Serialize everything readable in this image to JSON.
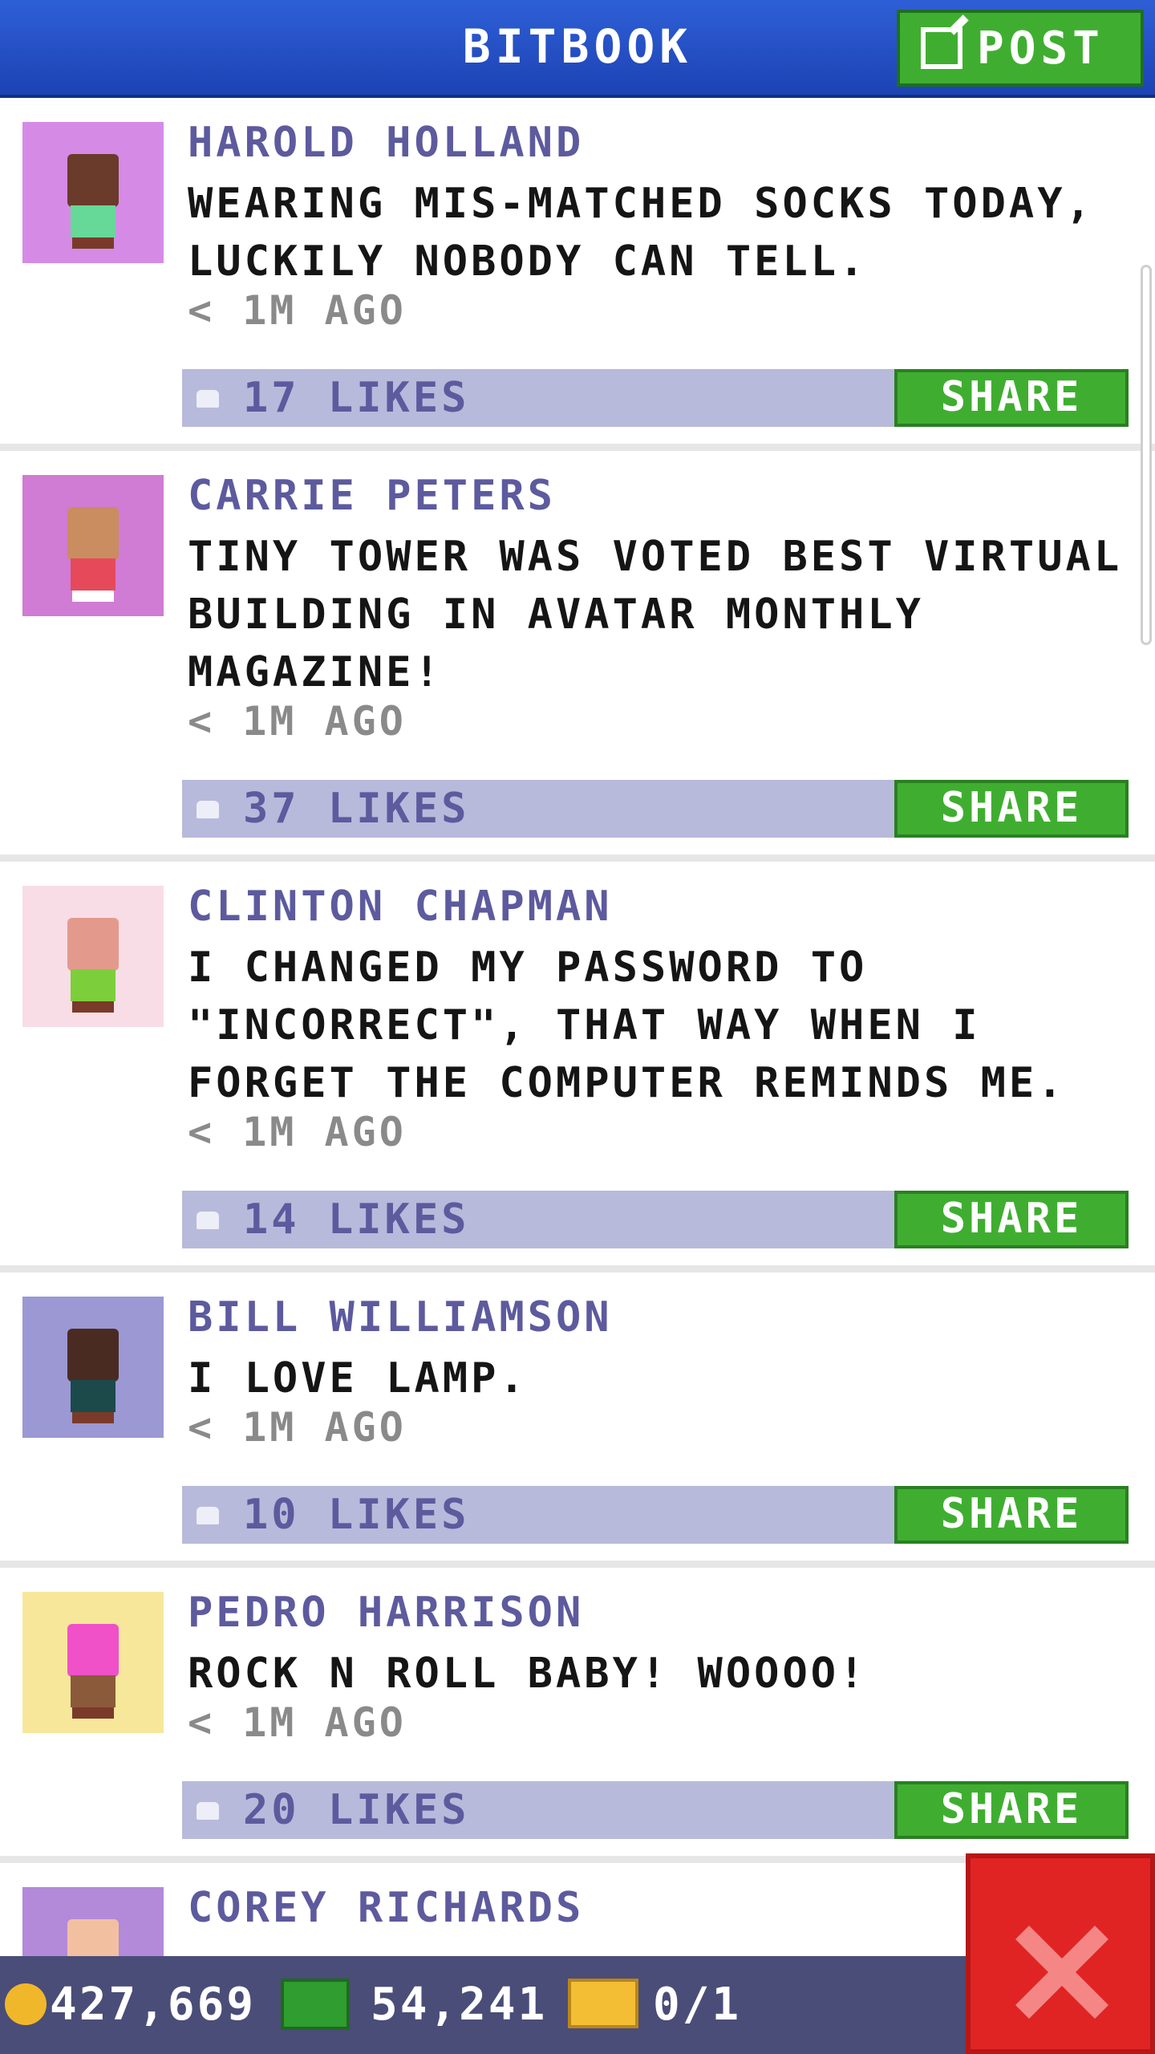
{
  "header": {
    "title": "BITBOOK",
    "post_label": "POST"
  },
  "posts": [
    {
      "name": "HAROLD HOLLAND",
      "message": "WEARING MIS-MATCHED SOCKS TODAY, LUCKILY NOBODY CAN TELL.",
      "time": "< 1M AGO",
      "likes": "17 LIKES",
      "share": "SHARE",
      "avatar_bg": "#d58be6"
    },
    {
      "name": "CARRIE PETERS",
      "message": "TINY TOWER WAS VOTED BEST VIRTUAL BUILDING IN AVATAR MONTHLY MAGAZINE!",
      "time": "< 1M AGO",
      "likes": "37 LIKES",
      "share": "SHARE",
      "avatar_bg": "#d07bd4"
    },
    {
      "name": "CLINTON CHAPMAN",
      "message": "I CHANGED MY PASSWORD TO \"INCORRECT\", THAT WAY WHEN I FORGET THE COMPUTER REMINDS ME.",
      "time": "< 1M AGO",
      "likes": "14 LIKES",
      "share": "SHARE",
      "avatar_bg": "#f8dde6"
    },
    {
      "name": "BILL WILLIAMSON",
      "message": "I LOVE LAMP.",
      "time": "< 1M AGO",
      "likes": "10 LIKES",
      "share": "SHARE",
      "avatar_bg": "#9b98d4"
    },
    {
      "name": "PEDRO HARRISON",
      "message": "ROCK N ROLL BABY! WOOOO!",
      "time": "< 1M AGO",
      "likes": "20 LIKES",
      "share": "SHARE",
      "avatar_bg": "#f7e79a"
    },
    {
      "name": "COREY RICHARDS",
      "avatar_bg": "#b28ad9"
    }
  ],
  "footer": {
    "coins": "427,669",
    "bux": "54,241",
    "tickets": "0/1"
  },
  "colors": {
    "header": "#1f4bc1",
    "share": "#3fae30",
    "likes_bar": "#b8badb",
    "name": "#5d5a9e",
    "close": "#e02424"
  }
}
